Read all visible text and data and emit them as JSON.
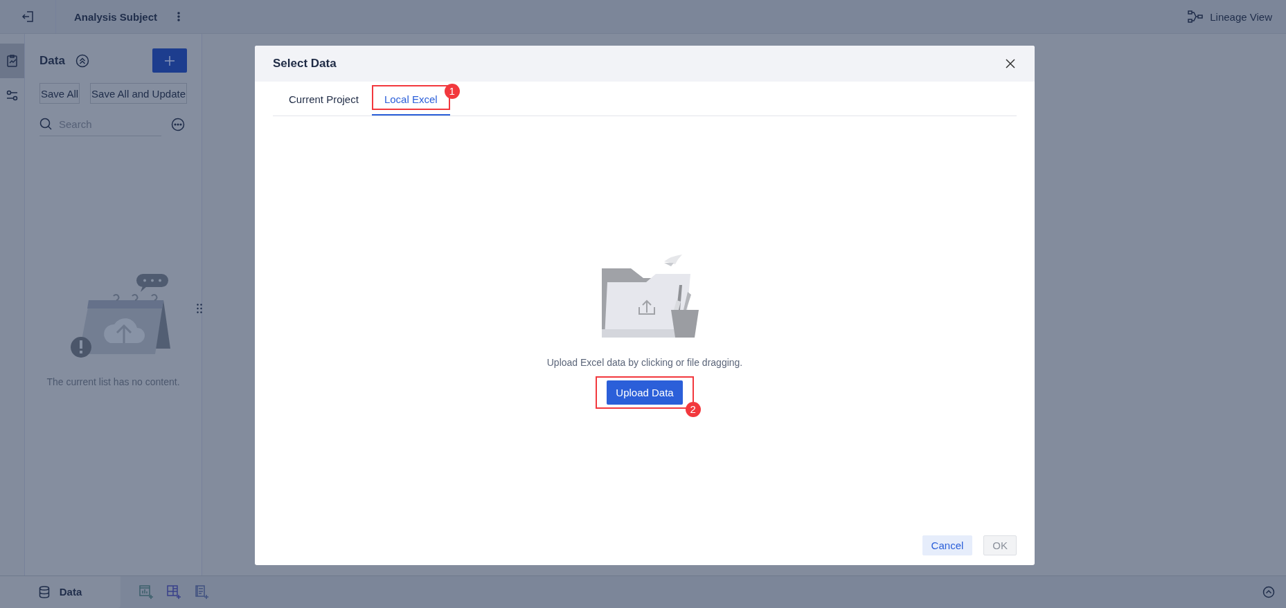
{
  "top_bar": {
    "title": "Analysis Subject",
    "lineage_link": "Lineage View"
  },
  "rail": [
    {
      "selected": true
    },
    {
      "selected": false
    }
  ],
  "sidebar": {
    "title": "Data",
    "buttons": [
      "Save All",
      "Save All and Update"
    ],
    "search": {
      "placeholder": "Search"
    },
    "empty_text": "The current list has no content."
  },
  "bottom_bar": {
    "tab": "Data"
  },
  "dialog": {
    "title": "Select Data",
    "tabs": [
      {
        "label": "Current Project",
        "selected": false
      },
      {
        "label": "Local Excel",
        "selected": true,
        "annotation": "1"
      }
    ],
    "hint": "Upload Excel data by clicking or file dragging.",
    "upload_button": {
      "label": "Upload Data",
      "annotation": "2"
    },
    "footer": [
      {
        "label": "Cancel",
        "disabled": false
      },
      {
        "label": "OK",
        "disabled": true
      }
    ]
  }
}
